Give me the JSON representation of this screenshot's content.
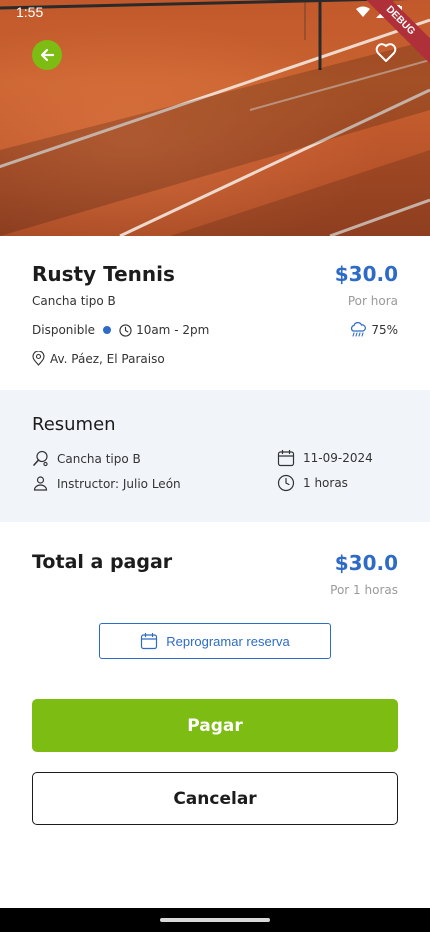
{
  "statusbar": {
    "time": "1:55",
    "debug_label": "DEBUG"
  },
  "venue": {
    "name": "Rusty Tennis",
    "price": "$30.0",
    "price_unit": "Por hora",
    "court_type": "Cancha tipo B",
    "availability": "Disponible",
    "hours": "10am - 2pm",
    "rain_chance": "75%",
    "address": "Av. Páez, El Paraiso"
  },
  "summary": {
    "title": "Resumen",
    "court": "Cancha tipo B",
    "instructor": "Instructor: Julio León",
    "date": "11-09-2024",
    "duration": "1 horas"
  },
  "total": {
    "label": "Total a pagar",
    "price": "$30.0",
    "unit": "Por 1 horas"
  },
  "actions": {
    "reschedule": "Reprogramar reserva",
    "pay": "Pagar",
    "cancel": "Cancelar"
  },
  "colors": {
    "accent_green": "#7cbc13",
    "accent_blue": "#2e6bc6",
    "summary_bg": "#f1f5fa"
  }
}
